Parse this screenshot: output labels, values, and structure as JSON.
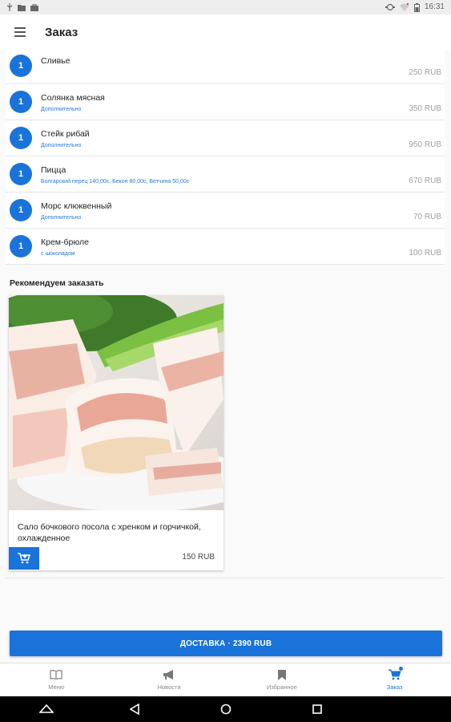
{
  "status_bar": {
    "time": "16:31",
    "left_icons": [
      "usb-icon",
      "folder-icon",
      "briefcase-icon"
    ],
    "right_icons": [
      "sync-icon",
      "wifi-off-icon",
      "battery-icon"
    ]
  },
  "app_bar": {
    "title": "Заказ"
  },
  "order_items": [
    {
      "qty": "1",
      "name": "Сливье",
      "extra": "",
      "price": "250 RUB"
    },
    {
      "qty": "1",
      "name": "Солянка мясная",
      "extra": "Дополнительно",
      "price": "350 RUB"
    },
    {
      "qty": "1",
      "name": "Стейк рибай",
      "extra": "Дополнительно",
      "price": "950 RUB"
    },
    {
      "qty": "1",
      "name": "Пицца",
      "extra": "Болгарский перец 140,00с, Бекон 80,00с, Ветчина 50,00с",
      "price": "670 RUB"
    },
    {
      "qty": "1",
      "name": "Морс клюквенный",
      "extra": "Дополнительно",
      "price": "70 RUB"
    },
    {
      "qty": "1",
      "name": "Крем-брюле",
      "extra": "с шоколадом",
      "price": "100 RUB"
    }
  ],
  "recommend": {
    "title": "Рекомендуем заказать",
    "item": {
      "name": "Сало бочкового посола с хренком и горчичкой, охлажденное",
      "price": "150 RUB",
      "image_icon": "salo-photo"
    }
  },
  "delivery_button": {
    "label": "ДОСТАВКА · 2390 RUB"
  },
  "bottom_nav": [
    {
      "label": "Меню",
      "icon": "book-icon",
      "active": false
    },
    {
      "label": "Новости",
      "icon": "megaphone-icon",
      "active": false
    },
    {
      "label": "Избранное",
      "icon": "bookmark-icon",
      "active": false
    },
    {
      "label": "Заказ",
      "icon": "cart-icon",
      "active": true
    }
  ],
  "colors": {
    "accent": "#1a73d9",
    "price_gray": "#9e9e9e",
    "extra_link": "#2a7ad6"
  }
}
